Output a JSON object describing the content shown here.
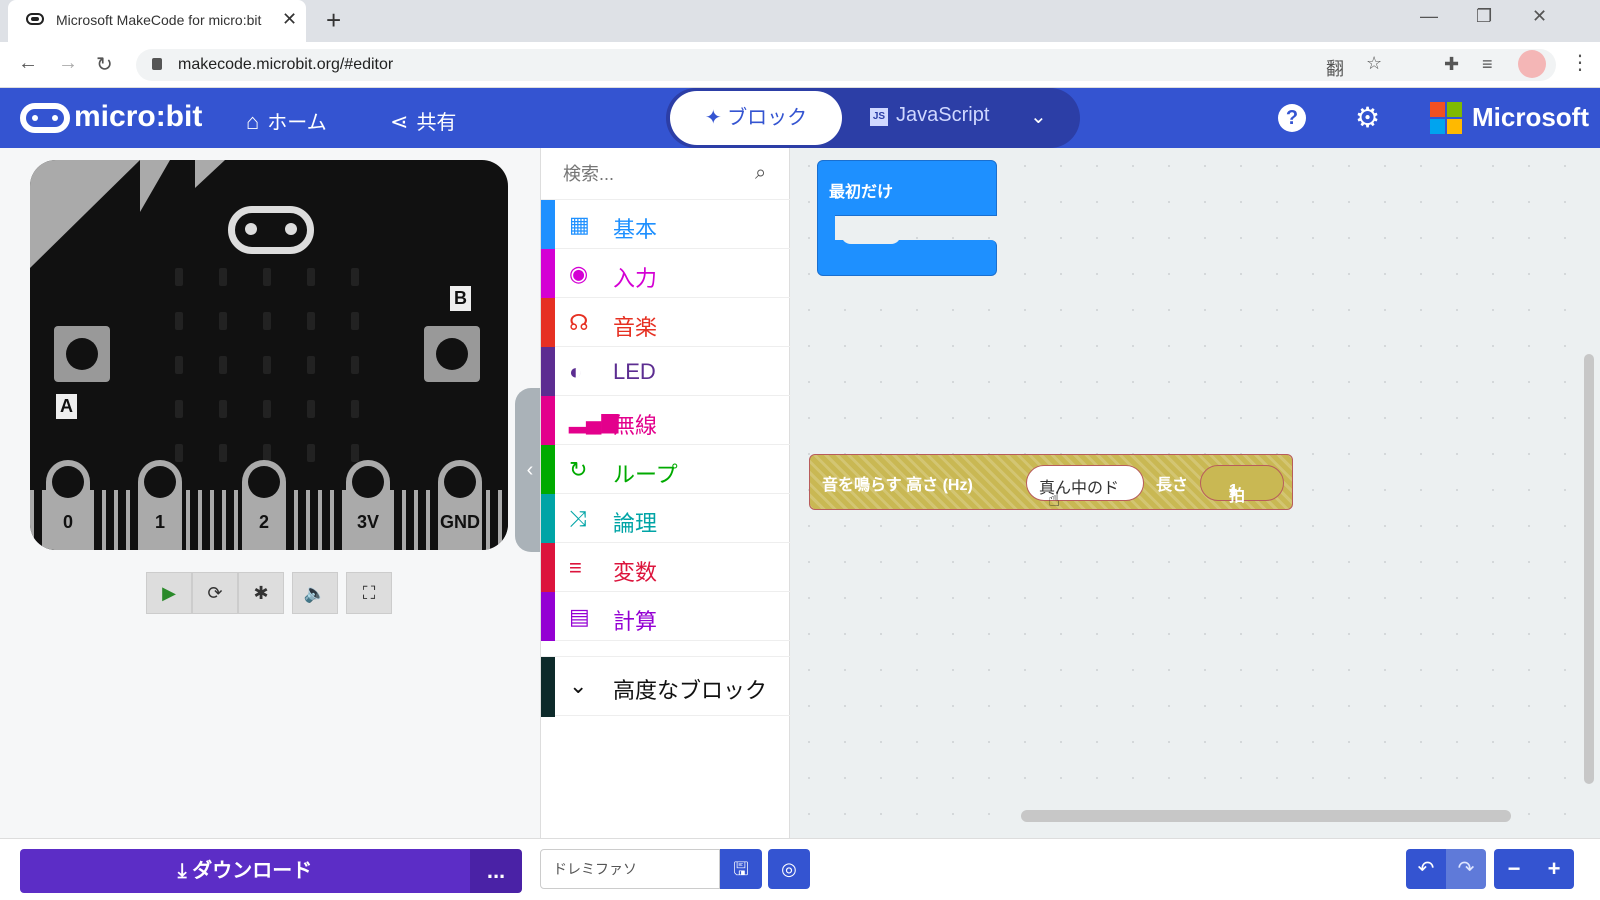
{
  "browser": {
    "tab_title": "Microsoft MakeCode for micro:bit",
    "tab_close": "✕",
    "new_tab": "+",
    "url": "makecode.microbit.org/#editor",
    "nav": {
      "back": "←",
      "forward": "→",
      "reload": "↻"
    },
    "window": {
      "minimize": "—",
      "restore": "❐",
      "close": "✕"
    },
    "icons": {
      "translate": "翻",
      "star": "☆",
      "extensions": "✚",
      "media": "≡",
      "menu": "⋮"
    }
  },
  "header": {
    "logo": "micro:bit",
    "home": "ホーム",
    "share": "共有",
    "blocks_tab": "ブロック",
    "js_tab": "JavaScript",
    "js_icon": "JS",
    "dropdown": "⌄",
    "help": "?",
    "settings": "⚙",
    "brand": "Microsoft",
    "brand_colors": [
      "#f25022",
      "#7fba00",
      "#00a4ef",
      "#ffb900"
    ],
    "accent": "#3454d1"
  },
  "simulator": {
    "button_a": "A",
    "button_b": "B",
    "pins": [
      "0",
      "1",
      "2",
      "3V",
      "GND"
    ],
    "controls": {
      "play": "▶",
      "restart": "⟳",
      "debug": "✱",
      "sound": "🔈",
      "fullscreen": "⛶"
    },
    "collapse": "‹"
  },
  "toolbox": {
    "search_placeholder": "検索...",
    "search_icon": "⌕",
    "categories": [
      {
        "label": "基本",
        "icon": "▦",
        "color": "#1e90ff"
      },
      {
        "label": "入力",
        "icon": "◉",
        "color": "#d400d4"
      },
      {
        "label": "音楽",
        "icon": "☊",
        "color": "#e63022"
      },
      {
        "label": "LED",
        "icon": "◐",
        "color": "#5c2d91"
      },
      {
        "label": "無線",
        "icon": "▂▄▆",
        "color": "#e3008c"
      },
      {
        "label": "ループ",
        "icon": "↻",
        "color": "#00aa00"
      },
      {
        "label": "論理",
        "icon": "⤨",
        "color": "#00a4a6"
      },
      {
        "label": "変数",
        "icon": "≡",
        "color": "#dc143c"
      },
      {
        "label": "計算",
        "icon": "▤",
        "color": "#9400d3"
      }
    ],
    "advanced": {
      "label": "高度なブロック",
      "icon": "⌄"
    }
  },
  "workspace": {
    "on_start": "最初だけ",
    "tone_block": {
      "prefix": "音を鳴らす 高さ (Hz)",
      "note": "真ん中のド",
      "length_label": "長さ",
      "beat_value": "1",
      "beat_caret": "▾",
      "beat_unit": "拍"
    }
  },
  "bottom": {
    "download": "ダウンロード",
    "download_icon": "⤓",
    "more": "...",
    "project_name": "ドレミファソ",
    "save_icon": "🖫",
    "github_icon": "◎",
    "undo": "↶",
    "redo": "↷",
    "zoom_out": "−",
    "zoom_in": "+"
  }
}
